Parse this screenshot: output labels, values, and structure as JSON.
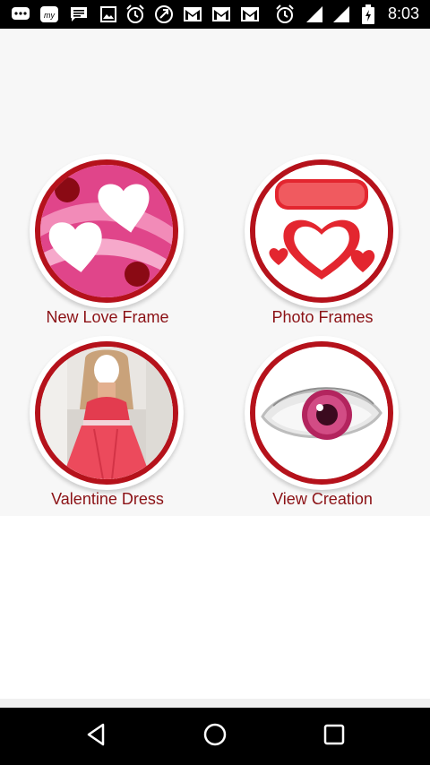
{
  "status_bar": {
    "time": "8:03",
    "icons": [
      "chat-bubble-icon",
      "my-app-icon",
      "message-icon",
      "image-icon",
      "alarm-icon",
      "sync-icon",
      "gmail-icon",
      "gmail-icon",
      "gmail-icon",
      "alarm-icon",
      "signal-icon",
      "signal-icon",
      "battery-charging-icon"
    ],
    "my_icon_text": "my"
  },
  "menu": {
    "items": [
      {
        "label": "New Love Frame",
        "icon": "hearts-frame-icon"
      },
      {
        "label": "Photo Frames",
        "icon": "love-heart-icon"
      },
      {
        "label": "Valentine Dress",
        "icon": "dress-photo-icon"
      },
      {
        "label": "View Creation",
        "icon": "eye-icon"
      }
    ]
  },
  "nav_bar": {
    "back": "back-icon",
    "home": "home-icon",
    "recents": "recents-icon"
  },
  "colors": {
    "ring": "#b5121b",
    "label": "#8b1115",
    "background": "#f7f7f7"
  }
}
